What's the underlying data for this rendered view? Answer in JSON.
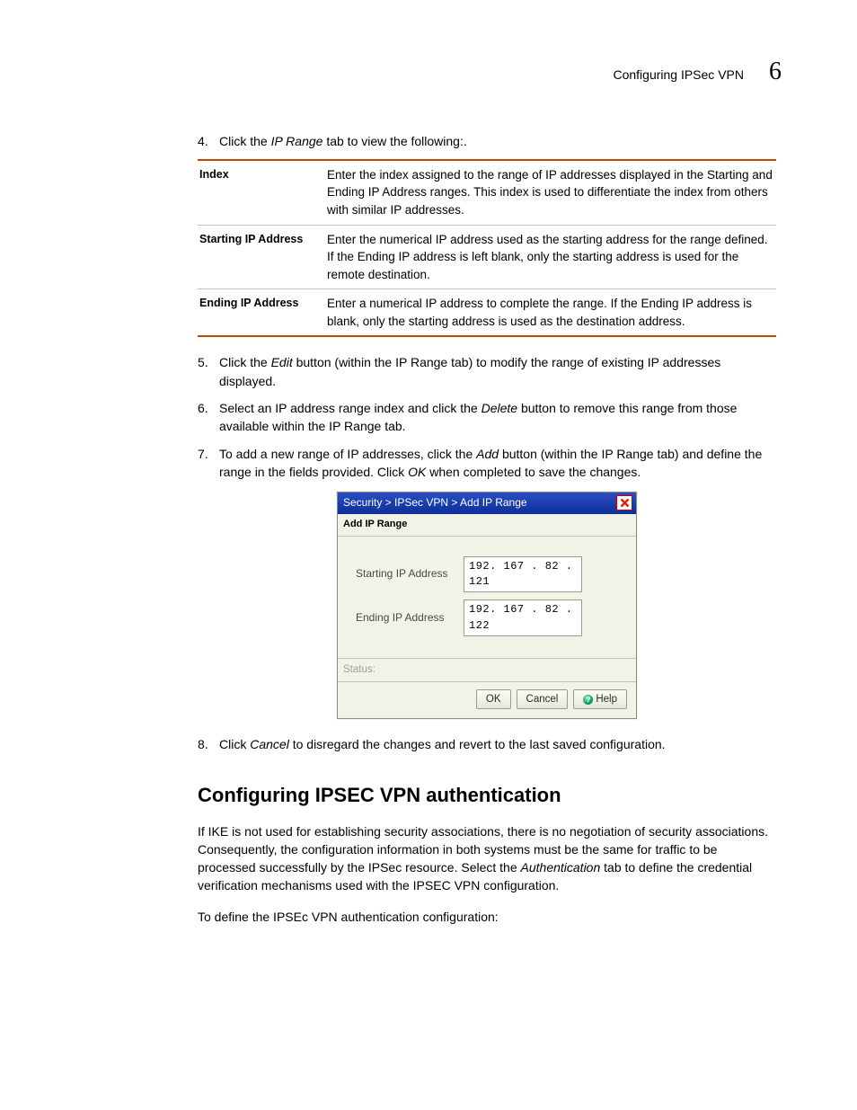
{
  "header": {
    "title": "Configuring IPSec VPN",
    "chapter_number": "6"
  },
  "steps": {
    "s4": {
      "num": "4.",
      "pre": "Click the ",
      "em": "IP Range",
      "post": " tab to view the following:."
    },
    "s5": {
      "num": "5.",
      "pre": "Click the ",
      "em": "Edit",
      "post": " button (within the IP Range tab) to modify the range of existing IP addresses displayed."
    },
    "s6": {
      "num": "6.",
      "pre": "Select an IP address range index and click the ",
      "em": "Delete",
      "post": " button to remove this range from those available within the IP Range tab."
    },
    "s7": {
      "num": "7.",
      "pre": "To add a new range of IP addresses, click the ",
      "em1": "Add",
      "mid": " button (within the IP Range tab) and define the range in the fields provided. Click ",
      "em2": "OK",
      "post": " when completed to save the changes."
    },
    "s8": {
      "num": "8.",
      "pre": "Click ",
      "em": "Cancel",
      "post": " to disregard the changes and revert to the last saved configuration."
    }
  },
  "table": {
    "rows": [
      {
        "name": "Index",
        "desc": "Enter the index assigned to the range of IP addresses displayed in the Starting and Ending IP Address ranges. This index is used to differentiate the index from others with similar IP addresses."
      },
      {
        "name": "Starting IP Address",
        "desc": "Enter the numerical IP address used as the starting address for the range defined. If the Ending IP address is left blank, only the starting address is used for the remote destination."
      },
      {
        "name": "Ending IP Address",
        "desc": "Enter a numerical IP address to complete the range. If the Ending IP address is blank, only the starting address is used as the destination address."
      }
    ]
  },
  "dialog": {
    "breadcrumb": "Security > IPSec VPN > Add IP Range",
    "subhead": "Add IP Range",
    "fields": {
      "start_label": "Starting IP Address",
      "start_value": "192. 167 .  82 . 121",
      "end_label": "Ending IP Address",
      "end_value": "192. 167 .  82 . 122"
    },
    "status_label": "Status:",
    "buttons": {
      "ok": "OK",
      "cancel": "Cancel",
      "help": "Help"
    }
  },
  "section": {
    "heading": "Configuring IPSEC VPN authentication",
    "p1_pre": "If IKE is not used for establishing security associations, there is no negotiation of security associations. Consequently, the configuration information in both systems must be the same for traffic to be processed successfully by the IPSec resource. Select the ",
    "p1_em": "Authentication",
    "p1_post": " tab to define the credential verification mechanisms used with the IPSEC VPN configuration.",
    "p2": "To define the IPSEc VPN authentication configuration:"
  }
}
